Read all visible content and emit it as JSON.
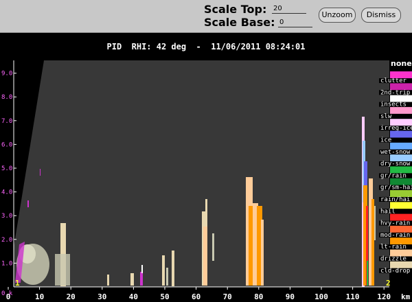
{
  "toolbar": {
    "scale_top_label": "Scale Top:",
    "scale_top_value": "20",
    "scale_base_label": "Scale Base:",
    "scale_base_value": "0",
    "unzoom_label": "Unzoom",
    "dismiss_label": "Dismiss"
  },
  "plot_title": "PID  RHI: 42 deg  -  11/06/2011 08:24:01",
  "axes": {
    "x_ticks": [
      "0",
      "10",
      "20",
      "30",
      "40",
      "50",
      "60",
      "70",
      "80",
      "90",
      "100",
      "110",
      "120"
    ],
    "x_unit": "km",
    "y_ticks": [
      "1.0",
      "2.0",
      "3.0",
      "4.0",
      "5.0",
      "6.0",
      "7.0",
      "8.0",
      "9.0"
    ],
    "y_origin_label": "0.k",
    "corner_left": "1",
    "corner_right": "2"
  },
  "legend": {
    "title": "none",
    "items": [
      {
        "label": "clutter",
        "color": "#ff33cc"
      },
      {
        "label": "2nd-trip",
        "color": "#cc22aa"
      },
      {
        "label": "insects",
        "color": "#ffffff"
      },
      {
        "label": "slw",
        "color": "#ff99cc"
      },
      {
        "label": "irreg-ice",
        "color": "#ffccff"
      },
      {
        "label": "ice",
        "color": "#6666ee"
      },
      {
        "label": "wet-snow",
        "color": "#66aaff"
      },
      {
        "label": "dry-snow",
        "color": "#99ccff"
      },
      {
        "label": "gr/rain",
        "color": "#22bb44"
      },
      {
        "label": "gr/sm-hai",
        "color": "#118833"
      },
      {
        "label": "rain/hai",
        "color": "#99cc33"
      },
      {
        "label": "hail",
        "color": "#ffff33"
      },
      {
        "label": "hvy-rain",
        "color": "#ff2222"
      },
      {
        "label": "mod-rain",
        "color": "#ff6633"
      },
      {
        "label": "lt-rain",
        "color": "#ff9900"
      },
      {
        "label": "drizzle",
        "color": "#ffcc99"
      },
      {
        "label": "cld-drop",
        "color": "#e8d8b0"
      }
    ]
  },
  "colors": {
    "plot_bg": "#383838",
    "blocked": "#000000",
    "ytick": "#ff66ff"
  }
}
